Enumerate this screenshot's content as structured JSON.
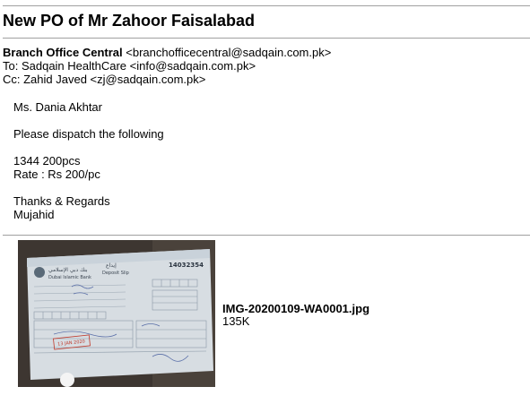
{
  "message": {
    "subject": "New PO of Mr Zahoor Faisalabad",
    "from_name": "Branch Office Central",
    "from_email": "<branchofficecentral@sadqain.com.pk>",
    "to_line": "To: Sadqain HealthCare <info@sadqain.com.pk>",
    "cc_line": "Cc: Zahid Javed <zj@sadqain.com.pk>",
    "body_lines": [
      "Ms. Dania Akhtar",
      "Please dispatch the following",
      "1344   200pcs",
      "Rate : Rs 200/pc",
      "Thanks & Regards",
      "Mujahid"
    ]
  },
  "attachment": {
    "filename": "IMG-20200109-WA0001.jpg",
    "size": "135K",
    "slip": {
      "bank_name_ar": "بنك دبي الإسلامي",
      "bank_name_en": "Dubai Islamic Bank",
      "slip_title_ar": "إيداع",
      "slip_title_en": "Deposit Slip",
      "slip_number": "14032354",
      "stamp_date": "13 JAN 2020"
    }
  }
}
